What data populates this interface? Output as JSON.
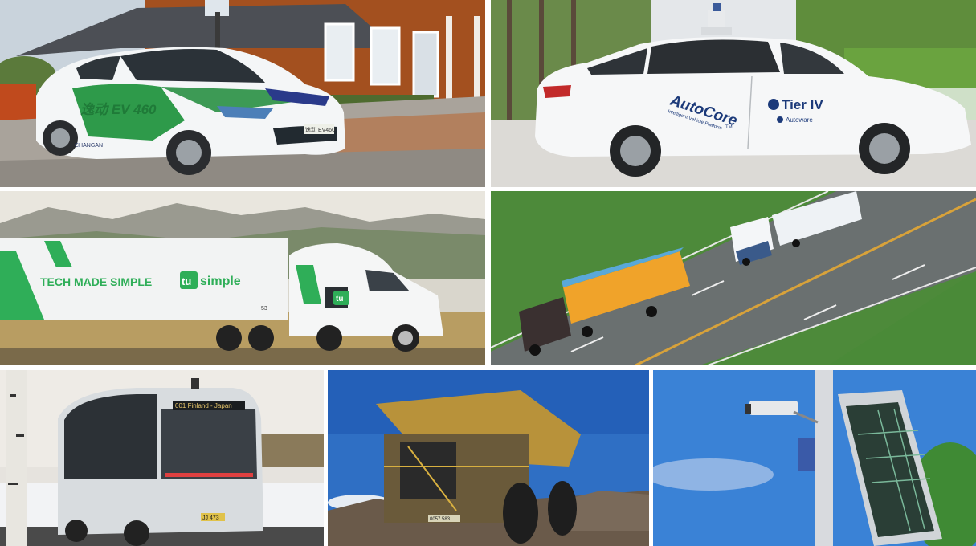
{
  "tiles": {
    "ev_car": {
      "brand_sub": "CHANGAN",
      "model_text": "逸动 EV 460",
      "plate_text": "逸动 EV460"
    },
    "autocore_car": {
      "autocore_logo": "AutoCore",
      "autocore_tm": "TM",
      "autocore_tagline": "Intelligent Vehicle Platform",
      "tier4_logo": "Tier IV",
      "autoware_logo": "Autoware"
    },
    "tusimple_truck": {
      "trailer_slogan": "TECH MADE SIMPLE",
      "trailer_brand": "simple",
      "brand_badge": "tu",
      "cab_badge": "tu",
      "unit_number": "53"
    },
    "highway_trucks": {},
    "shuttle_bus": {
      "route_display": "001 Finland - Japan",
      "plate": "JJ 473"
    },
    "mining_truck": {
      "plate": "0057 583"
    },
    "roadside_unit": {}
  }
}
